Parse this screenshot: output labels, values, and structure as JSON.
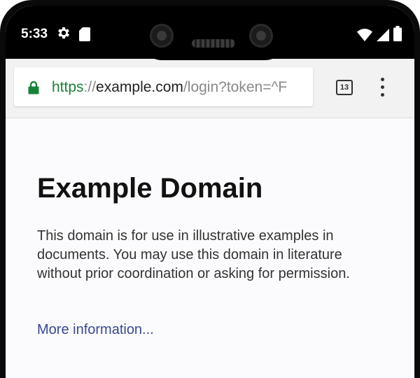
{
  "status_bar": {
    "time": "5:33",
    "icons": [
      "gear-icon",
      "sd-card-icon",
      "wifi-icon",
      "signal-icon",
      "battery-icon"
    ]
  },
  "browser": {
    "url_scheme": "https",
    "url_separator": "://",
    "url_host": "example.com",
    "url_path": "/login?token=^F",
    "tab_count": "13",
    "icons": [
      "lock-icon",
      "tab-switcher-icon",
      "overflow-menu-icon"
    ],
    "colors": {
      "secure": "#188038",
      "link": "#38488f"
    }
  },
  "page": {
    "title": "Example Domain",
    "body": "This domain is for use in illustrative examples in documents. You may use this domain in literature without prior coordination or asking for permission.",
    "link_text": "More information..."
  }
}
